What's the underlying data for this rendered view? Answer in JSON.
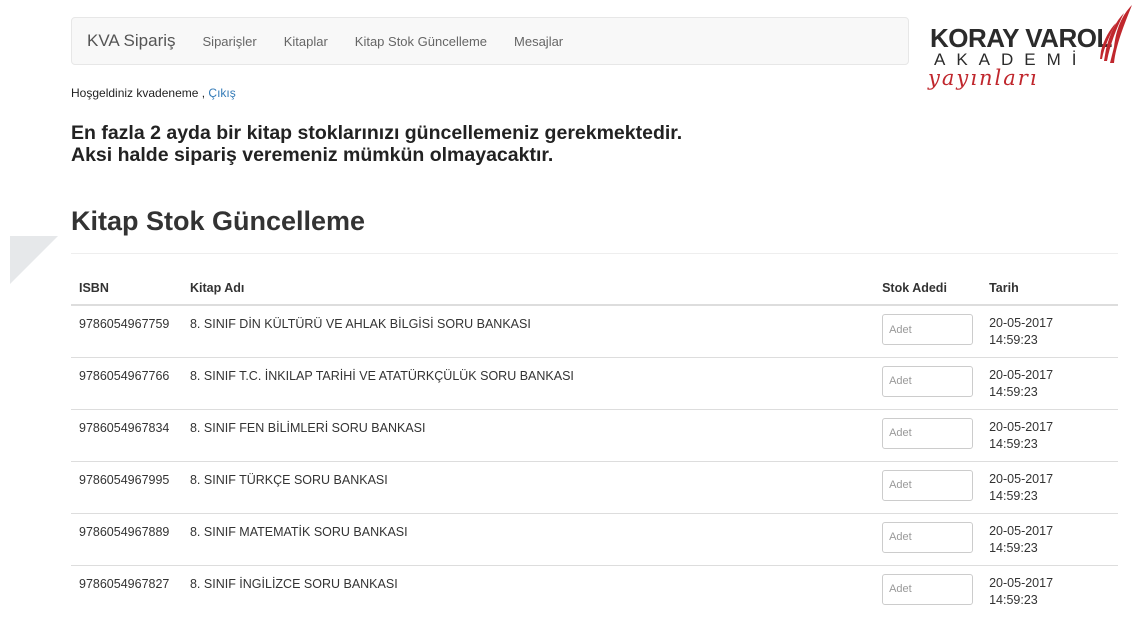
{
  "navbar": {
    "brand": "KVA Sipariş",
    "links": [
      "Siparişler",
      "Kitaplar",
      "Kitap Stok Güncelleme",
      "Mesajlar"
    ]
  },
  "logo": {
    "line1": "KORAY VAROL",
    "line2": "AKADEMİ",
    "line3": "yayınları",
    "brand_color": "#c0272d"
  },
  "welcome": {
    "text": "Hoşgeldiniz kvadeneme ,",
    "logout_label": "Çıkış"
  },
  "notice": {
    "line1": "En fazla 2 ayda bir kitap stoklarınızı güncellemeniz gerekmektedir.",
    "line2": "Aksi halde sipariş veremeniz mümkün olmayacaktır."
  },
  "page_title": "Kitap Stok Güncelleme",
  "table": {
    "headers": {
      "isbn": "ISBN",
      "name": "Kitap Adı",
      "stock": "Stok Adedi",
      "date": "Tarih"
    },
    "rows": [
      {
        "isbn": "9786054967759",
        "name": "8. SINIF DİN KÜLTÜRÜ VE AHLAK BİLGİSİ SORU BANKASI",
        "placeholder": "Adet",
        "date": "20-05-2017",
        "time": "14:59:23"
      },
      {
        "isbn": "9786054967766",
        "name": "8. SINIF T.C. İNKILAP TARİHİ VE ATATÜRKÇÜLÜK SORU BANKASI",
        "placeholder": "Adet",
        "date": "20-05-2017",
        "time": "14:59:23"
      },
      {
        "isbn": "9786054967834",
        "name": "8. SINIF FEN BİLİMLERİ SORU BANKASI",
        "placeholder": "Adet",
        "date": "20-05-2017",
        "time": "14:59:23"
      },
      {
        "isbn": "9786054967995",
        "name": "8. SINIF TÜRKÇE SORU BANKASI",
        "placeholder": "Adet",
        "date": "20-05-2017",
        "time": "14:59:23"
      },
      {
        "isbn": "9786054967889",
        "name": "8. SINIF MATEMATİK SORU BANKASI",
        "placeholder": "Adet",
        "date": "20-05-2017",
        "time": "14:59:23"
      },
      {
        "isbn": "9786054967827",
        "name": "8. SINIF İNGİLİZCE SORU BANKASI",
        "placeholder": "Adet",
        "date": "20-05-2017",
        "time": "14:59:23"
      }
    ]
  }
}
